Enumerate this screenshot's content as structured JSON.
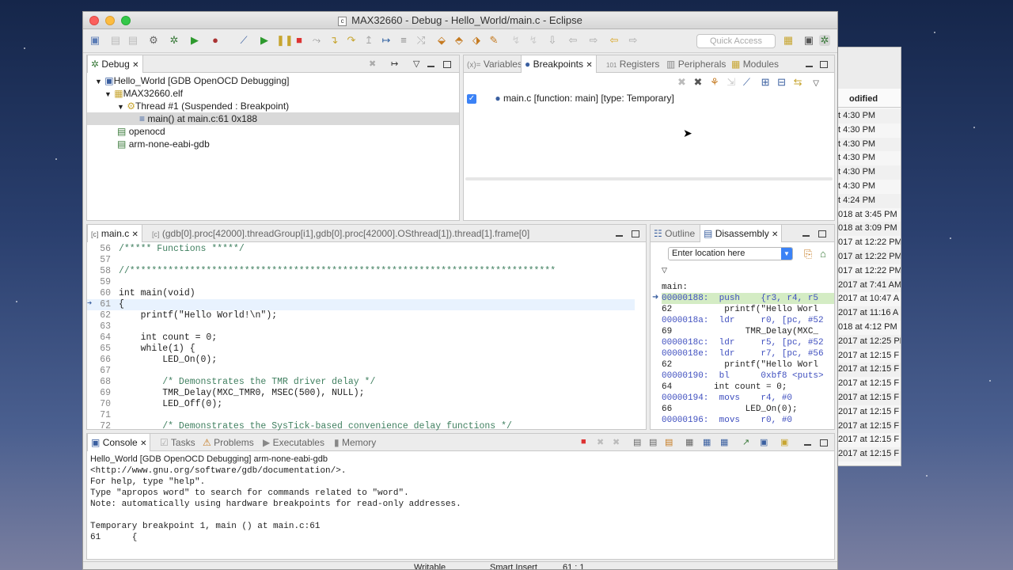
{
  "window": {
    "title": "MAX32660 - Debug - Hello_World/main.c - Eclipse",
    "quick_access": "Quick Access"
  },
  "bg_window": {
    "column": "odified",
    "rows": [
      "t 4:30 PM",
      "t 4:30 PM",
      "t 4:30 PM",
      "t 4:30 PM",
      "t 4:30 PM",
      "t 4:30 PM",
      "t 4:24 PM",
      "018 at 3:45 PM",
      "018 at 3:09 PM",
      "017 at 12:22 PM",
      "017 at 12:22 PM",
      "017 at 12:22 PM",
      "2017 at 7:41 AM",
      "2017 at 10:47 A",
      "2017 at 11:16 A",
      "018 at 4:12 PM",
      "2017 at 12:25 PM",
      "2017 at 12:15 F",
      "2017 at 12:15 F",
      "2017 at 12:15 F",
      "2017 at 12:15 F",
      "2017 at 12:15 F",
      "2017 at 12:15 F",
      "2017 at 12:15 F",
      "2017 at 12:15 F"
    ]
  },
  "debug": {
    "tab": "Debug",
    "tree": [
      "Hello_World [GDB OpenOCD Debugging]",
      "MAX32660.elf",
      "Thread #1 (Suspended : Breakpoint)",
      "main() at main.c:61 0x188",
      "openocd",
      "arm-none-eabi-gdb"
    ]
  },
  "bp": {
    "tabs": [
      "Variables",
      "Breakpoints",
      "Registers",
      "Peripherals",
      "Modules"
    ],
    "entries": [
      "main.c [function: main] [type: Temporary]"
    ]
  },
  "editor": {
    "tabs": [
      "main.c",
      "(gdb[0].proc[42000].threadGroup[i1],gdb[0].proc[42000].OSthread[1]).thread[1].frame[0]"
    ],
    "lines": [
      {
        "n": "56",
        "t": "/***** Functions *****/"
      },
      {
        "n": "57",
        "t": ""
      },
      {
        "n": "58",
        "t": "//******************************************************************************"
      },
      {
        "n": "59",
        "t": ""
      },
      {
        "n": "60",
        "t": "int main(void)"
      },
      {
        "n": "61",
        "t": "{"
      },
      {
        "n": "62",
        "t": "    printf(\"Hello World!\\n\");"
      },
      {
        "n": "63",
        "t": ""
      },
      {
        "n": "64",
        "t": "    int count = 0;"
      },
      {
        "n": "65",
        "t": "    while(1) {"
      },
      {
        "n": "66",
        "t": "        LED_On(0);"
      },
      {
        "n": "67",
        "t": ""
      },
      {
        "n": "68",
        "t": "        /* Demonstrates the TMR driver delay */"
      },
      {
        "n": "69",
        "t": "        TMR_Delay(MXC_TMR0, MSEC(500), NULL);"
      },
      {
        "n": "70",
        "t": "        LED_Off(0);"
      },
      {
        "n": "71",
        "t": ""
      },
      {
        "n": "72",
        "t": "        /* Demonstrates the SysTick-based convenience delay functions */"
      }
    ]
  },
  "disasm": {
    "tabs": [
      "Outline",
      "Disassembly"
    ],
    "location_placeholder": "Enter location here",
    "lines": [
      "main:",
      "00000188:  push    {r3, r4, r5",
      "62          printf(\"Hello Worl",
      "0000018a:  ldr     r0, [pc, #52",
      "69              TMR_Delay(MXC_",
      "0000018c:  ldr     r5, [pc, #52",
      "0000018e:  ldr     r7, [pc, #56",
      "62          printf(\"Hello Worl",
      "00000190:  bl      0xbf8 <puts>",
      "64        int count = 0;",
      "00000194:  movs    r4, #0",
      "66              LED_On(0);",
      "00000196:  movs    r0, #0"
    ]
  },
  "console": {
    "tabs": [
      "Console",
      "Tasks",
      "Problems",
      "Executables",
      "Memory"
    ],
    "header": "Hello_World [GDB OpenOCD Debugging] arm-none-eabi-gdb",
    "lines": [
      "<http://www.gnu.org/software/gdb/documentation/>.",
      "For help, type \"help\".",
      "Type \"apropos word\" to search for commands related to \"word\".",
      "Note: automatically using hardware breakpoints for read-only addresses.",
      "",
      "Temporary breakpoint 1, main () at main.c:61",
      "61      {"
    ]
  },
  "status": {
    "mode": "Writable",
    "insert": "Smart Insert",
    "pos": "61 : 1"
  }
}
